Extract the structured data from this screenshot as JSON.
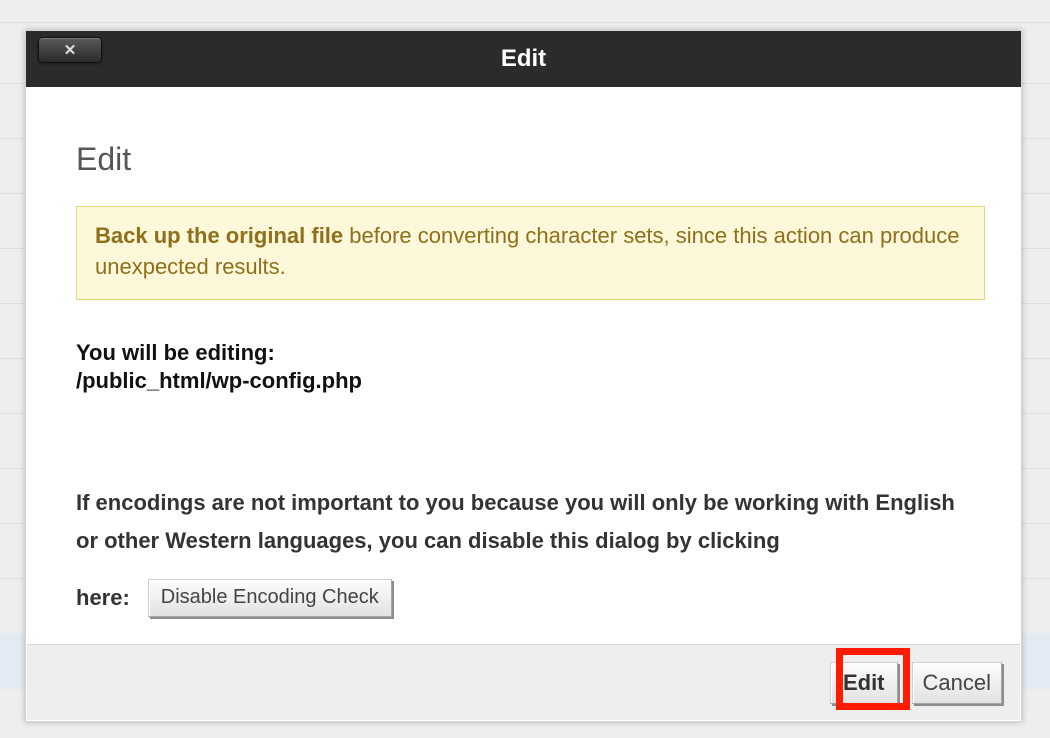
{
  "dialog": {
    "title": "Edit",
    "close_glyph": "✕",
    "heading": "Edit",
    "warning_bold": "Back up the original file",
    "warning_rest": " before converting character sets, since this action can produce unexpected results.",
    "editing_label": "You will be editing:",
    "editing_path": "/public_html/wp-config.php",
    "encoding_text": "If encodings are not important to you because you will only be working with English or other Western languages, you can disable this dialog by clicking",
    "encoding_here": "here:",
    "disable_btn": "Disable Encoding Check",
    "edit_btn": "Edit",
    "cancel_btn": "Cancel"
  }
}
